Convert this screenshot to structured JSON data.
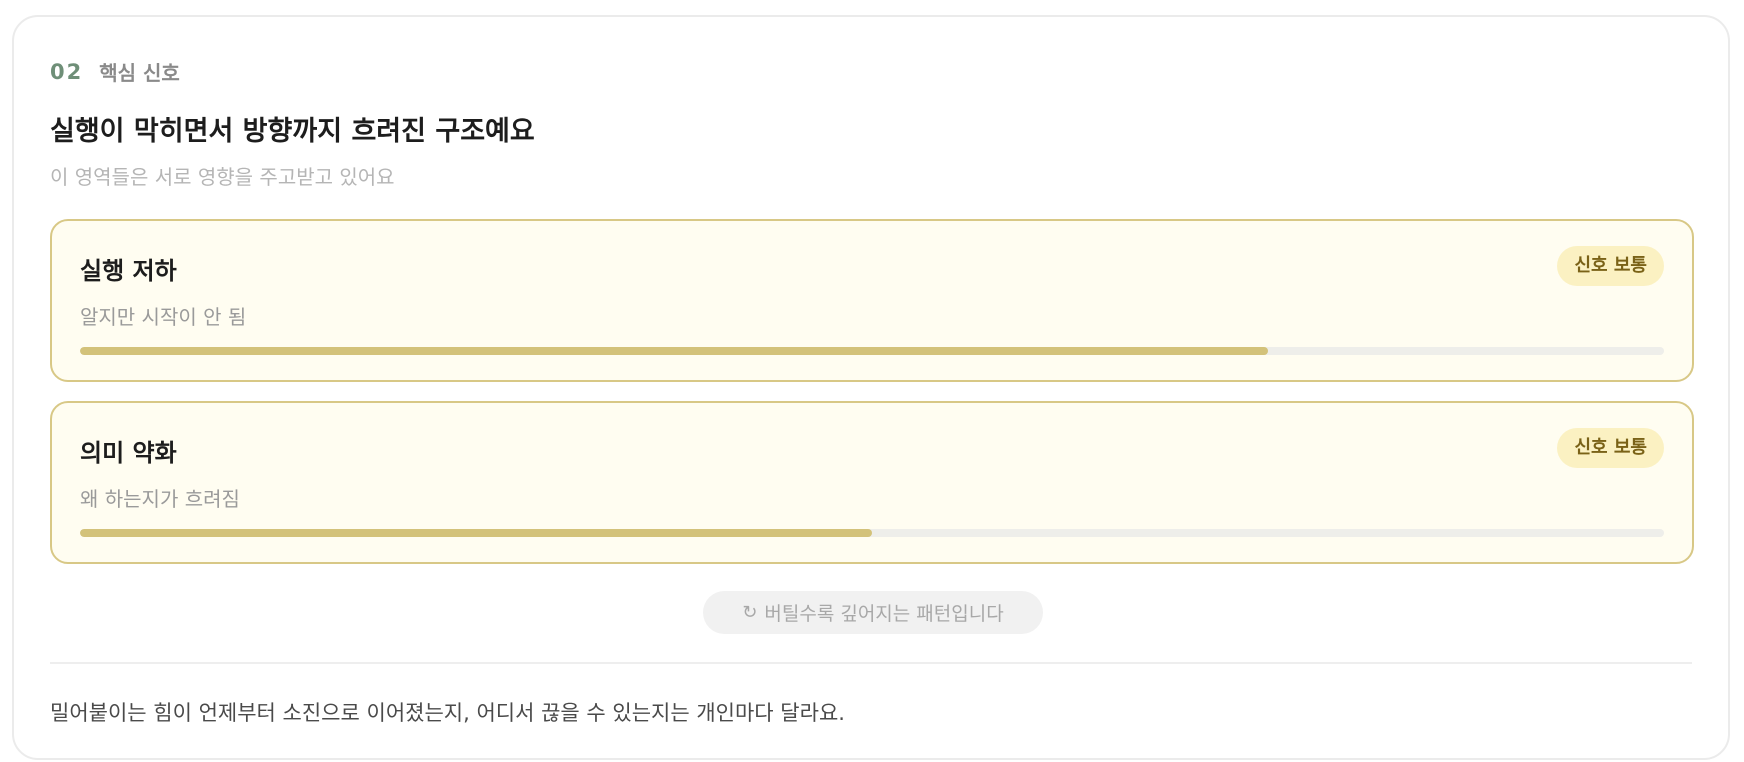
{
  "section": {
    "number": "02",
    "label": "핵심 신호"
  },
  "title": "실행이 막히면서 방향까지 흐려진 구조예요",
  "subtitle": "이 영역들은 서로 영향을 주고받고 있어요",
  "signals": [
    {
      "title": "실행 저하",
      "description": "알지만 시작이 안 됨",
      "badge": "신호 보통",
      "level_percent": 75
    },
    {
      "title": "의미 약화",
      "description": "왜 하는지가 흐려짐",
      "badge": "신호 보통",
      "level_percent": 50
    }
  ],
  "pattern": {
    "icon": "refresh-icon",
    "text": "버틸수록 깊어지는 패턴입니다"
  },
  "footer_note": "밀어붙이는 힘이 언제부터 소진으로 이어졌는지, 어디서 끊을 수 있는지는 개인마다 달라요.",
  "colors": {
    "accent_number": "#6f8f78",
    "card_border": "#d8c886",
    "card_background": "#fffdf1",
    "badge_background": "#fbf1c2",
    "badge_text": "#7a6217",
    "progress_fill": "#d3c27a"
  }
}
